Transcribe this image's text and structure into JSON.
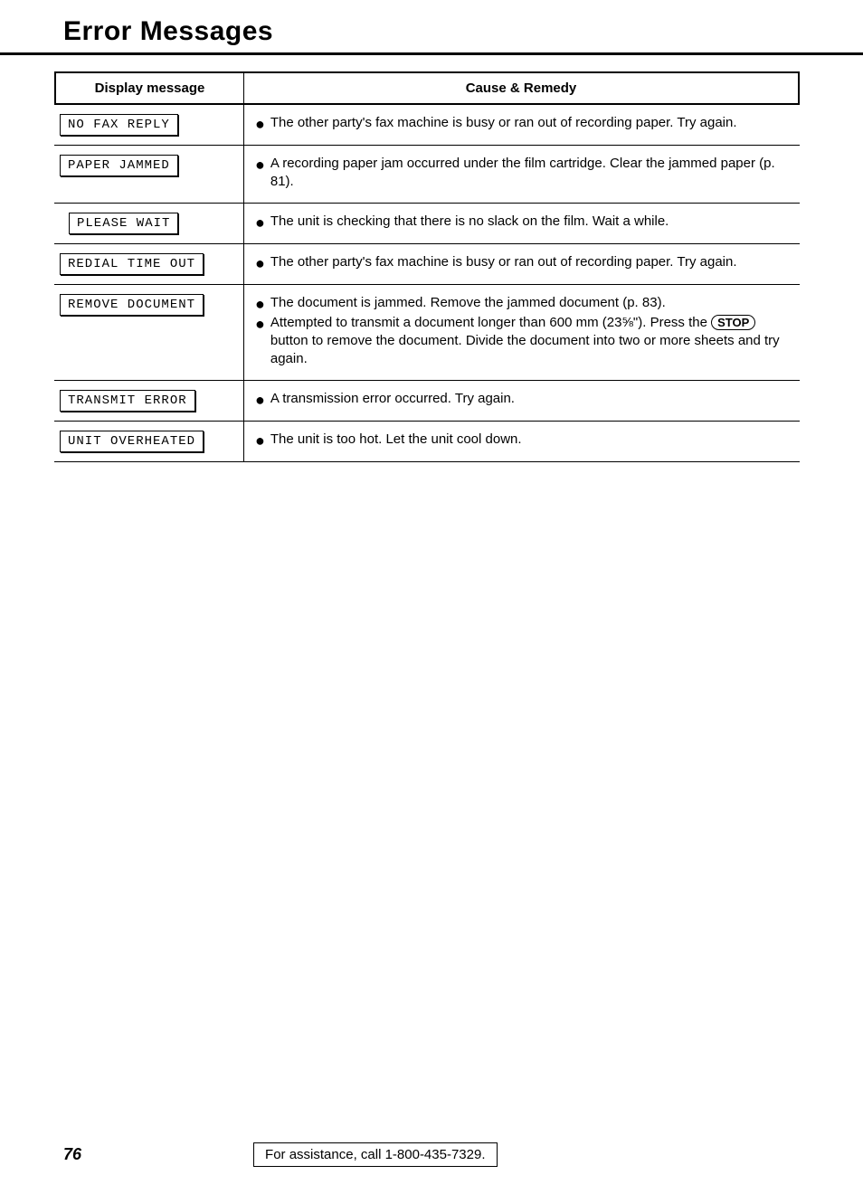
{
  "title": "Error Messages",
  "table": {
    "headers": {
      "msg": "Display message",
      "cause": "Cause & Remedy"
    },
    "rows": [
      {
        "msg": "NO FAX REPLY",
        "bullets": [
          "The other party's fax machine is busy or ran out of recording paper. Try again."
        ]
      },
      {
        "msg": "PAPER JAMMED",
        "bullets": [
          "A recording paper jam occurred under the film cartridge. Clear the jammed paper (p. 81)."
        ]
      },
      {
        "msg": "PLEASE WAIT",
        "bullets": [
          "The unit is checking that there is no slack on the film. Wait a while."
        ]
      },
      {
        "msg": "REDIAL TIME OUT",
        "bullets": [
          "The other party's fax machine is busy or ran out of recording paper. Try again."
        ]
      },
      {
        "msg": "REMOVE DOCUMENT",
        "bullets": [
          "The document is jammed. Remove the jammed document (p. 83).",
          {
            "pre": "Attempted to transmit a document longer than 600 mm (23⅝\"). Press the ",
            "key": "STOP",
            "post": " button to remove the document. Divide the document into two or more sheets and try again."
          }
        ]
      },
      {
        "msg": "TRANSMIT ERROR",
        "bullets": [
          "A transmission error occurred. Try again."
        ]
      },
      {
        "msg": "UNIT OVERHEATED",
        "bullets": [
          "The unit is too hot. Let the unit cool down."
        ]
      }
    ]
  },
  "footer": {
    "page": "76",
    "assist": "For assistance, call 1-800-435-7329."
  }
}
